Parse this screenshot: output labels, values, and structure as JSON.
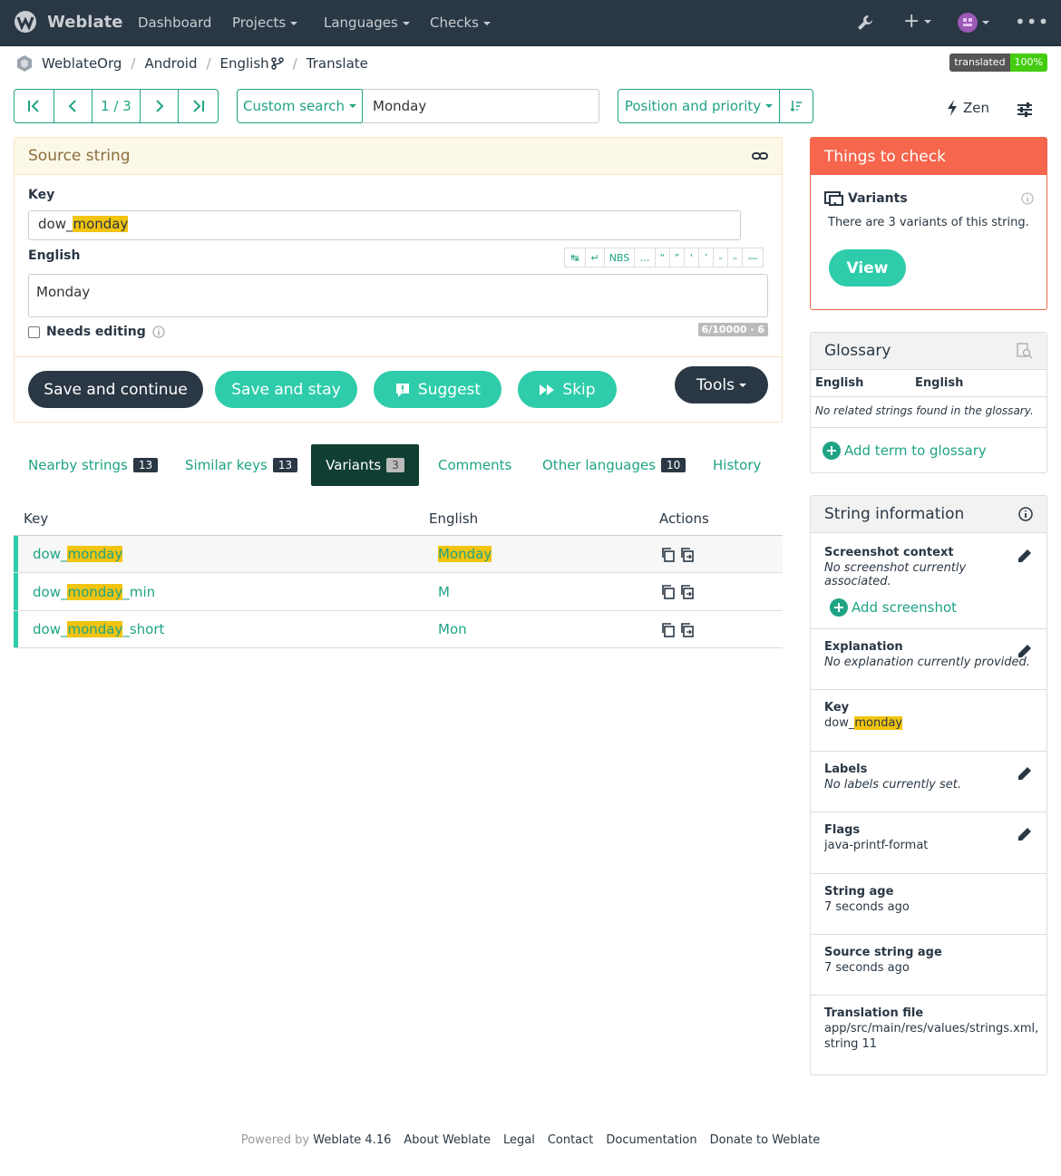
{
  "nav": {
    "brand": "Weblate",
    "dashboard": "Dashboard",
    "projects": "Projects",
    "languages": "Languages",
    "checks": "Checks"
  },
  "breadcrumb": {
    "project": "WeblateOrg",
    "component": "Android",
    "language": "English",
    "page": "Translate"
  },
  "status_badge": {
    "label": "translated",
    "value": "100%"
  },
  "pager": {
    "position": "1 / 3"
  },
  "search": {
    "mode": "Custom search",
    "query": "Monday"
  },
  "sort": {
    "label": "Position and priority"
  },
  "zen": {
    "label": "Zen"
  },
  "source_panel": {
    "title": "Source string",
    "key_label": "Key",
    "key_prefix": "dow_",
    "key_match": "monday",
    "lang_label": "English",
    "source_text": "Monday",
    "needs_editing": "Needs editing",
    "counter": "6/10000 · 6",
    "special_chars": [
      "↹",
      "↵",
      "NBS",
      "…",
      "“",
      "”",
      "‘",
      "’",
      "-",
      "–",
      "—"
    ]
  },
  "actions": {
    "save_continue": "Save and continue",
    "save_stay": "Save and stay",
    "suggest": "Suggest",
    "skip": "Skip",
    "tools": "Tools"
  },
  "tabs": [
    {
      "label": "Nearby strings",
      "count": "13"
    },
    {
      "label": "Similar keys",
      "count": "13"
    },
    {
      "label": "Variants",
      "count": "3"
    },
    {
      "label": "Comments"
    },
    {
      "label": "Other languages",
      "count": "10"
    },
    {
      "label": "History"
    }
  ],
  "variants_table": {
    "headers": [
      "Key",
      "English",
      "Actions"
    ],
    "rows": [
      {
        "key_pre": "dow_",
        "key_match": "monday",
        "key_post": "",
        "text": "Monday",
        "text_highlight": true
      },
      {
        "key_pre": "dow_",
        "key_match": "monday",
        "key_post": "_min",
        "text": "M",
        "text_highlight": false
      },
      {
        "key_pre": "dow_",
        "key_match": "monday",
        "key_post": "_short",
        "text": "Mon",
        "text_highlight": false
      }
    ]
  },
  "checks_panel": {
    "title": "Things to check",
    "check_name": "Variants",
    "check_desc": "There are 3 variants of this string.",
    "view_button": "View"
  },
  "glossary": {
    "title": "Glossary",
    "col1": "English",
    "col2": "English",
    "empty": "No related strings found in the glossary.",
    "add": "Add term to glossary"
  },
  "string_info": {
    "title": "String information",
    "screenshot_label": "Screenshot context",
    "screenshot_value": "No screenshot currently associated.",
    "add_screenshot": "Add screenshot",
    "explanation_label": "Explanation",
    "explanation_value": "No explanation currently provided.",
    "key_label": "Key",
    "key_prefix": "dow_",
    "key_match": "monday",
    "labels_label": "Labels",
    "labels_value": "No labels currently set.",
    "flags_label": "Flags",
    "flags_value": "java-printf-format",
    "age_label": "String age",
    "age_value": "7 seconds ago",
    "source_age_label": "Source string age",
    "source_age_value": "7 seconds ago",
    "file_label": "Translation file",
    "file_value": "app/src/main/res/values/strings.xml,",
    "file_value2": "string 11"
  },
  "footer": {
    "powered": "Powered by",
    "version": "Weblate 4.16",
    "about": "About Weblate",
    "legal": "Legal",
    "contact": "Contact",
    "docs": "Documentation",
    "donate": "Donate to Weblate"
  },
  "colors": {
    "accent": "#1fa385",
    "dark": "#2a3744",
    "button_green": "#2eccaa",
    "check_red": "#f6664c",
    "highlight": "#f1c40f"
  }
}
